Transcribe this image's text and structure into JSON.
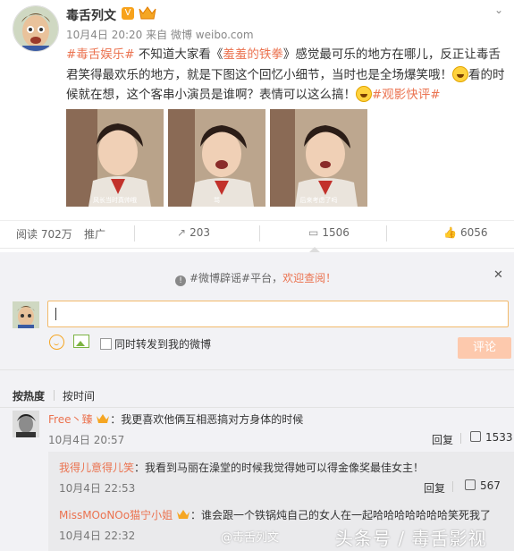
{
  "post": {
    "author": "毒舌列文",
    "vbadge": "V",
    "time": "10月4日 20:20",
    "from_label": "来自",
    "source": "微博 weibo.com",
    "text_parts": {
      "tag1": "#毒舌娱乐#",
      "t1": " 不知道大家看《",
      "link": "羞羞的铁拳",
      "t2": "》感觉最可乐的地方在哪儿，反正让毒舌君笑得最欢乐的地方，就是下图这个回忆小细节，当时也是全场爆笑哦！",
      "t3": "看的时候就在想，这个客串小演员是谁啊？表情可以这么搞！",
      "tag2": "#观影快评#"
    },
    "images": [
      {
        "caption": "风长当时真帅哦"
      },
      {
        "caption": "骂"
      },
      {
        "caption": "后来考虑了吗"
      }
    ]
  },
  "stats": {
    "reads": "阅读 702万",
    "promote": "推广",
    "reposts": "203",
    "comments": "1506",
    "likes": "6056"
  },
  "comment_box": {
    "notice_prefix": "#微博辟谣#平台，",
    "notice_link": "欢迎查阅！",
    "close": "✕",
    "repost_label": "同时转发到我的微博",
    "submit_label": "评论"
  },
  "sort": {
    "hot": "按热度",
    "time": "按时间"
  },
  "comments": [
    {
      "user": "Free丶臻",
      "text": "：我更喜欢他俩互相恶搞对方身体的时候",
      "time": "10月4日 20:57",
      "reply": "回复",
      "likes": "1533"
    }
  ],
  "sub_comments": [
    {
      "user": "我得儿意得儿笑",
      "text": "：我看到马丽在澡堂的时候我觉得她可以得金像奖最佳女主！",
      "time": "10月4日 22:53",
      "reply": "回复",
      "likes": "567"
    },
    {
      "user": "MissMOoNOo猫宁小姐",
      "text": "：谁会跟一个铁锅炖自己的女人在一起哈哈哈哈哈哈哈笑死我了",
      "time": "10月4日 22:32"
    }
  ],
  "watermark": {
    "small": "@毒舌列文",
    "large": "头条号 / 毒舌影视"
  },
  "colors": {
    "accent": "#eb7350",
    "submit_bg": "#fdc9ad",
    "panel_bg": "#f2f2f5"
  }
}
